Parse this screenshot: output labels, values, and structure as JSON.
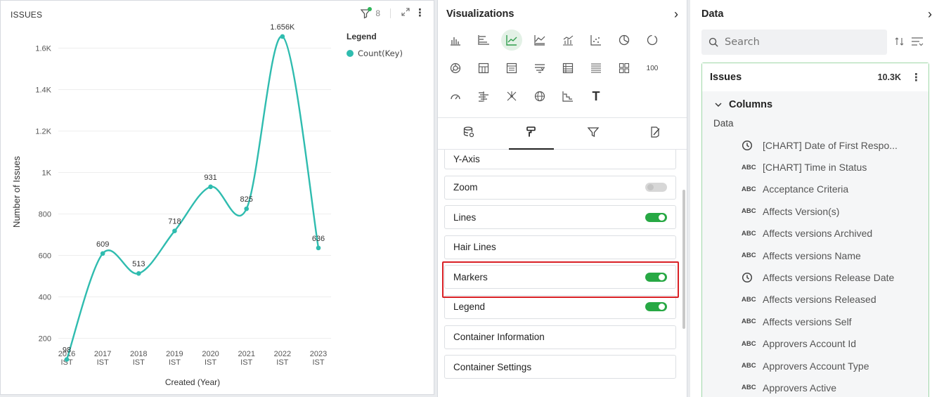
{
  "chart_panel": {
    "title": "ISSUES",
    "filter_count": "8",
    "legend_title": "Legend"
  },
  "chart_data": {
    "type": "line",
    "categories": [
      "2016\nIST",
      "2017\nIST",
      "2018\nIST",
      "2019\nIST",
      "2020\nIST",
      "2021\nIST",
      "2022\nIST",
      "2023\nIST"
    ],
    "series": [
      {
        "name": "Count(Key)",
        "values": [
          98,
          609,
          513,
          718,
          931,
          825,
          1656,
          636
        ],
        "labels": [
          "98",
          "609",
          "513",
          "718",
          "931",
          "825",
          "1.656K",
          "636"
        ],
        "color": "#2fbcaf"
      }
    ],
    "yticks": [
      200,
      400,
      600,
      800,
      1000,
      1200,
      1400,
      1600
    ],
    "ytick_labels": [
      "200",
      "400",
      "600",
      "800",
      "1K",
      "1.2K",
      "1.4K",
      "1.6K"
    ],
    "ylim": [
      100,
      1700
    ],
    "xlabel": "Created (Year)",
    "ylabel": "Number of Issues",
    "grid": true,
    "legend_position": "top-right",
    "smooth": true,
    "markers": true
  },
  "viz_panel": {
    "title": "Visualizations",
    "chart_icons": [
      "bar-chart-icon",
      "horizontal-bar-icon",
      "line-chart-icon",
      "area-chart-icon",
      "combo-chart-icon",
      "scatter-chart-icon",
      "pie-chart-icon",
      "donut-chart-icon",
      "sunburst-icon",
      "pivot-table-icon",
      "detail-table-icon",
      "funnel-table-icon",
      "table-icon",
      "list-table-icon",
      "grid-table-icon",
      "number-100-icon",
      "gauge-icon",
      "bullet-icon",
      "network-icon",
      "globe-map-icon",
      "step-chart-icon",
      "text-icon"
    ],
    "number_icon_label": "100",
    "text_icon_label": "T",
    "active_chart": "line-chart-icon",
    "tabs": [
      "database-icon",
      "paint-roller-icon",
      "filter-icon",
      "style-icon"
    ],
    "active_tab": "paint-roller-icon",
    "settings": [
      {
        "label": "Y-Axis",
        "toggle": null,
        "partial": true
      },
      {
        "label": "Zoom",
        "toggle": "off"
      },
      {
        "label": "Lines",
        "toggle": "on"
      },
      {
        "label": "Hair Lines",
        "toggle": null
      },
      {
        "label": "Markers",
        "toggle": "on",
        "highlighted": true
      },
      {
        "label": "Legend",
        "toggle": "on"
      },
      {
        "label": "Container Information",
        "toggle": null
      },
      {
        "label": "Container Settings",
        "toggle": null
      }
    ]
  },
  "data_panel": {
    "title": "Data",
    "search_placeholder": "Search",
    "dataset_name": "Issues",
    "dataset_count": "10.3K",
    "columns_label": "Columns",
    "group_label": "Data",
    "fields": [
      {
        "type": "clock",
        "label": "[CHART] Date of First Respo..."
      },
      {
        "type": "ABC",
        "label": "[CHART] Time in Status"
      },
      {
        "type": "ABC",
        "label": "Acceptance Criteria"
      },
      {
        "type": "ABC",
        "label": "Affects Version(s)"
      },
      {
        "type": "ABC",
        "label": "Affects versions Archived"
      },
      {
        "type": "ABC",
        "label": "Affects versions Name"
      },
      {
        "type": "clock",
        "label": "Affects versions Release Date"
      },
      {
        "type": "ABC",
        "label": "Affects versions Released"
      },
      {
        "type": "ABC",
        "label": "Affects versions Self"
      },
      {
        "type": "ABC",
        "label": "Approvers Account Id"
      },
      {
        "type": "ABC",
        "label": "Approvers Account Type"
      },
      {
        "type": "ABC",
        "label": "Approvers Active"
      }
    ]
  },
  "colors": {
    "series": "#2fbcaf",
    "toggle_on": "#27a844",
    "highlight": "#d92025",
    "dataset_border": "#9fd8a8",
    "filter_dot": "#2eb65a"
  }
}
